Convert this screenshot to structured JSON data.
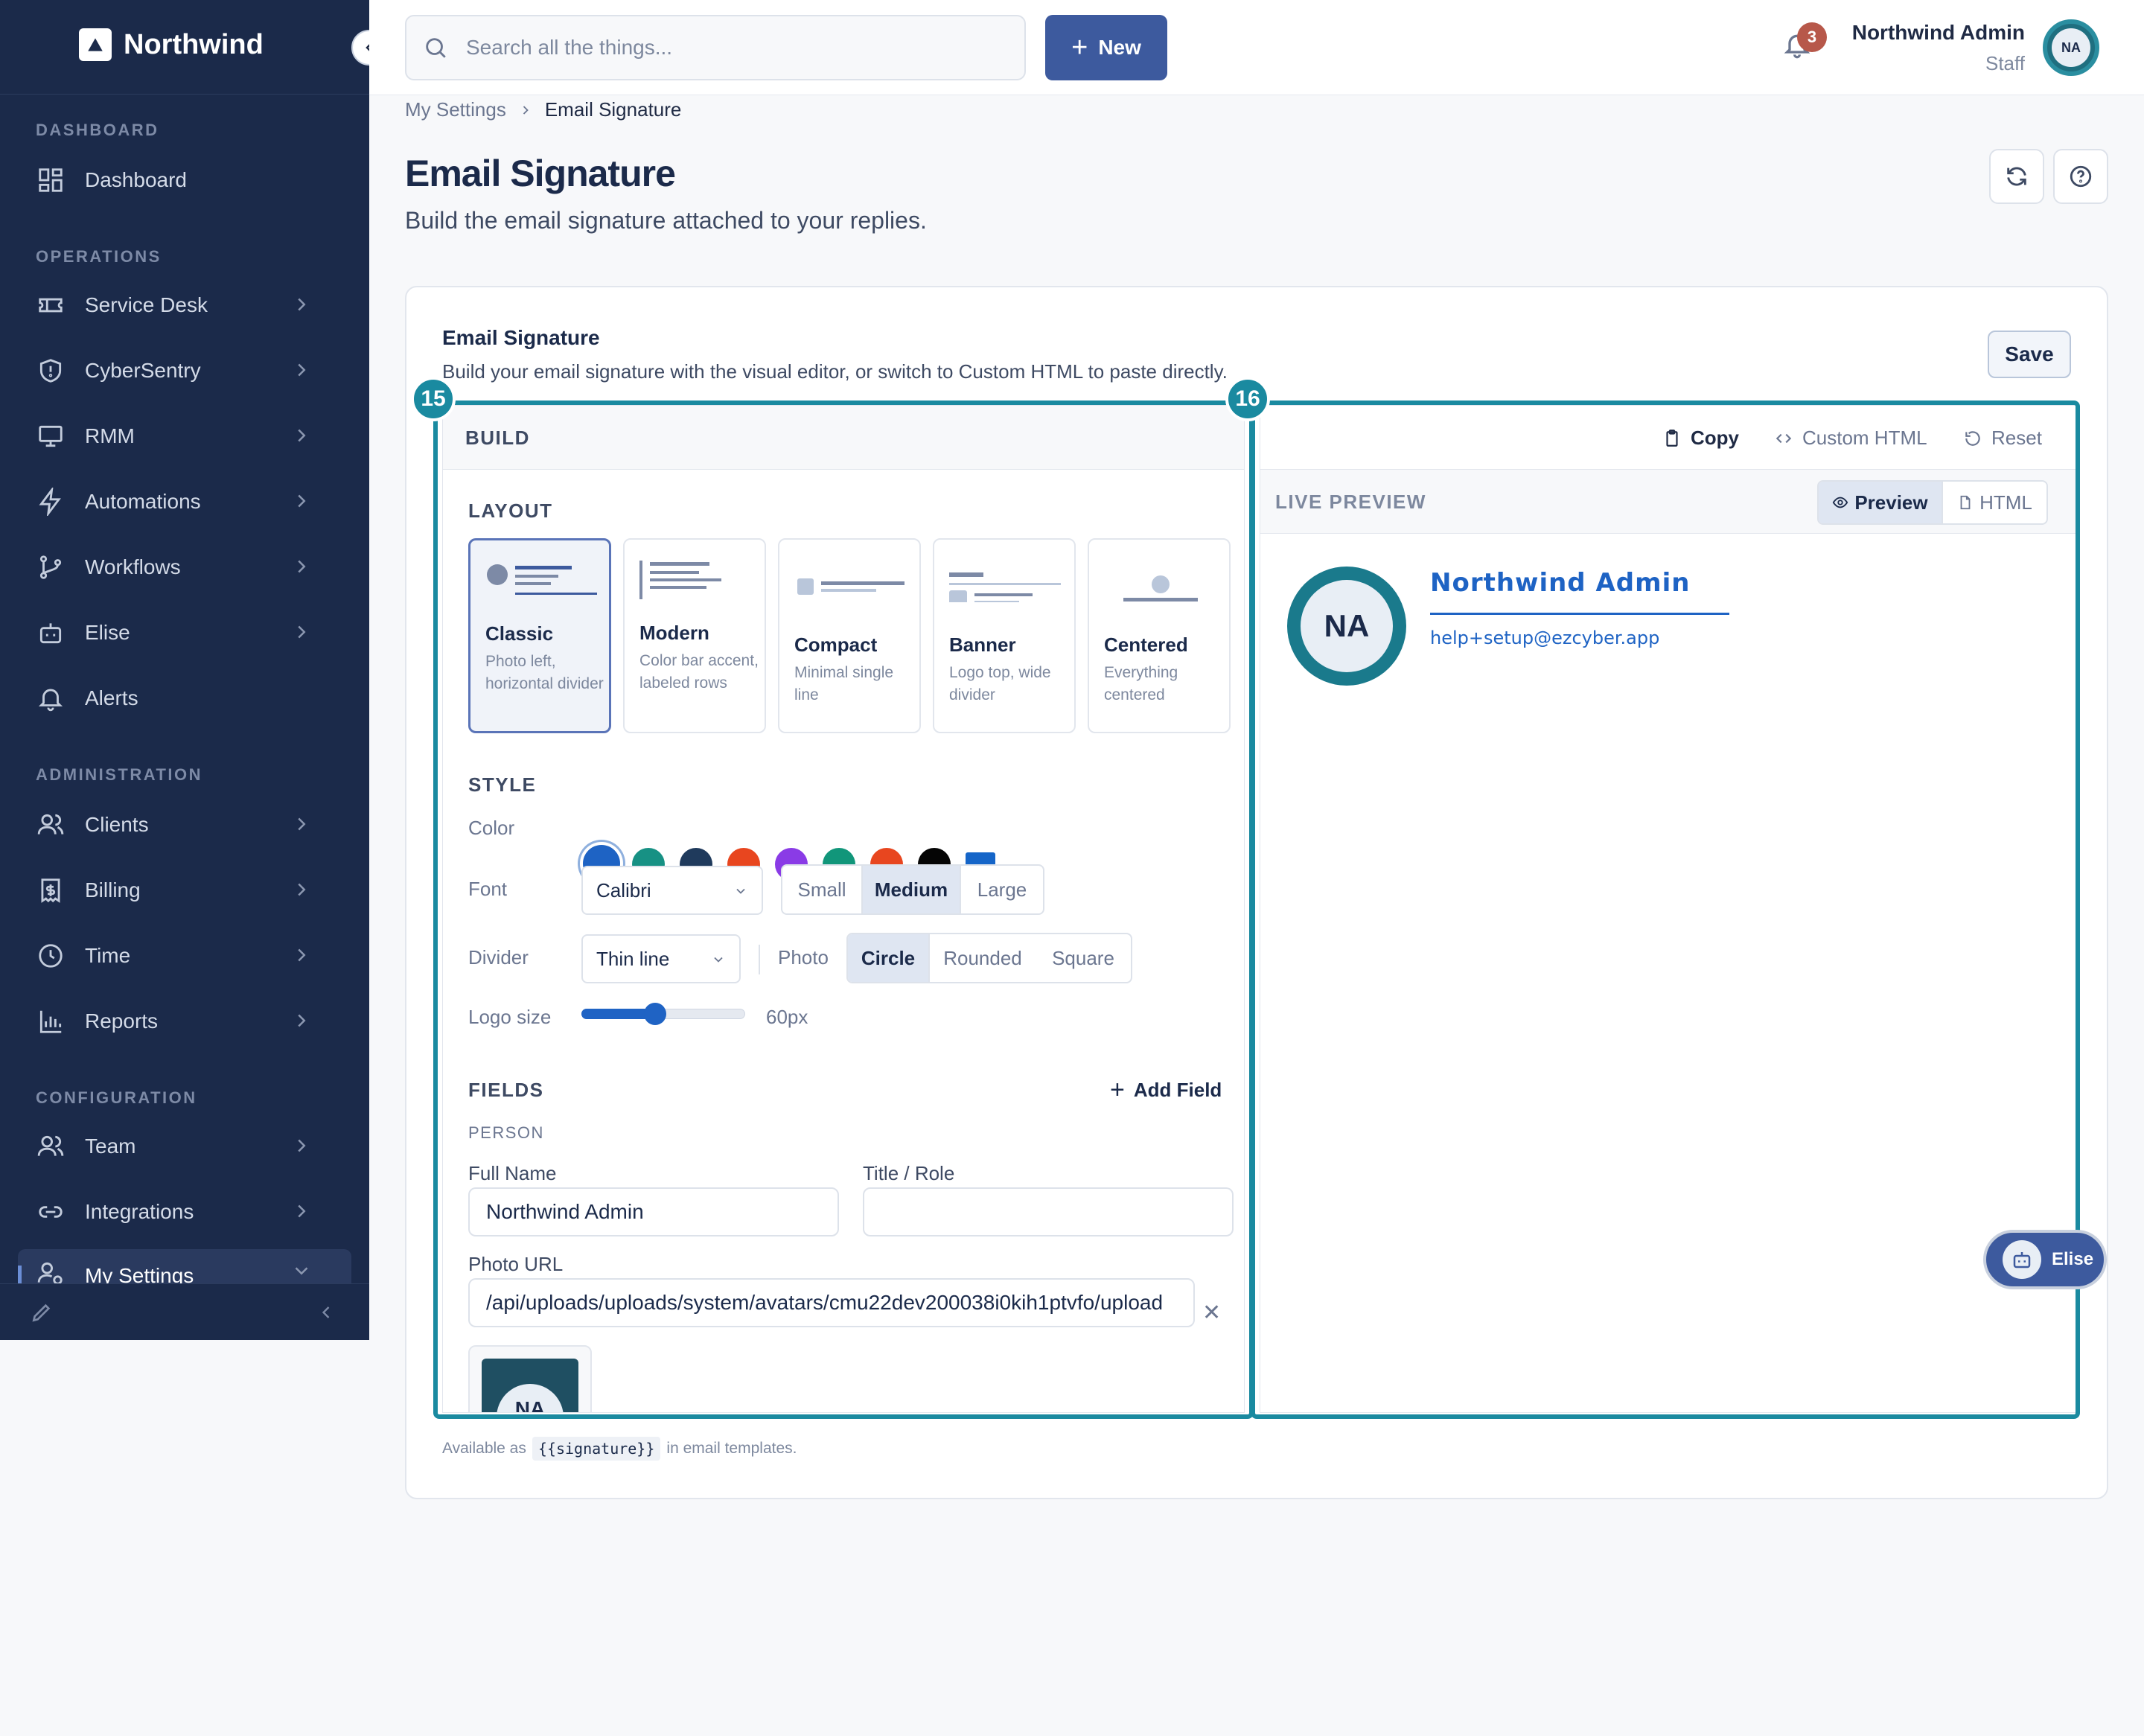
{
  "brand": {
    "name": "Northwind"
  },
  "sidebar": {
    "sections": [
      "DASHBOARD",
      "OPERATIONS",
      "ADMINISTRATION",
      "CONFIGURATION"
    ],
    "items": [
      {
        "label": "Dashboard",
        "icon": "grid-icon"
      },
      {
        "label": "Service Desk",
        "icon": "ticket-icon"
      },
      {
        "label": "CyberSentry",
        "icon": "shield-icon"
      },
      {
        "label": "RMM",
        "icon": "monitor-icon"
      },
      {
        "label": "Automations",
        "icon": "bolt-icon"
      },
      {
        "label": "Workflows",
        "icon": "branch-icon"
      },
      {
        "label": "Elise",
        "icon": "bot-icon"
      },
      {
        "label": "Alerts",
        "icon": "bell-icon"
      },
      {
        "label": "Clients",
        "icon": "users-icon"
      },
      {
        "label": "Billing",
        "icon": "receipt-icon"
      },
      {
        "label": "Time",
        "icon": "clock-icon"
      },
      {
        "label": "Reports",
        "icon": "bar-chart-icon"
      },
      {
        "label": "Team",
        "icon": "users-icon"
      },
      {
        "label": "Integrations",
        "icon": "link-icon"
      },
      {
        "label": "My Settings",
        "icon": "user-cog-icon"
      }
    ]
  },
  "topbar": {
    "search_placeholder": "Search all the things...",
    "new_label": "New",
    "notification_count": "3",
    "user_name": "Northwind Admin",
    "user_role": "Staff",
    "user_initials": "NA"
  },
  "breadcrumb": {
    "parent": "My Settings",
    "current": "Email Signature"
  },
  "page": {
    "title": "Email Signature",
    "subtitle": "Build the email signature attached to your replies."
  },
  "card": {
    "title": "Email Signature",
    "description": "Build your email signature with the visual editor, or switch to Custom HTML to paste directly.",
    "save_label": "Save"
  },
  "markers": {
    "build": "15",
    "preview": "16"
  },
  "build": {
    "header": "BUILD",
    "layout_label": "LAYOUT",
    "layouts": [
      {
        "title": "Classic",
        "desc": "Photo left, horizontal divider",
        "selected": true
      },
      {
        "title": "Modern",
        "desc": "Color bar accent, labeled rows",
        "selected": false
      },
      {
        "title": "Compact",
        "desc": "Minimal single line",
        "selected": false
      },
      {
        "title": "Banner",
        "desc": "Logo top, wide divider",
        "selected": false
      },
      {
        "title": "Centered",
        "desc": "Everything centered",
        "selected": false
      }
    ],
    "style_label": "STYLE",
    "color_label": "Color",
    "colors": [
      "#1e63c4",
      "#179184",
      "#1f3a5c",
      "#e8461f",
      "#8a3be6",
      "#11967a",
      "#e8461f",
      "#050505",
      "#1565c8"
    ],
    "selected_color": "#1e63c4",
    "font_label": "Font",
    "font_value": "Calibri",
    "sizes": [
      "Small",
      "Medium",
      "Large"
    ],
    "selected_size": "Medium",
    "divider_label": "Divider",
    "divider_value": "Thin line",
    "photo_label": "Photo",
    "photo_shapes": [
      "Circle",
      "Rounded",
      "Square"
    ],
    "selected_photo_shape": "Circle",
    "logo_size_label": "Logo size",
    "logo_size_value": "60px",
    "logo_size_fraction": 0.45,
    "fields_label": "FIELDS",
    "add_field_label": "Add Field",
    "person_label": "PERSON",
    "full_name_label": "Full Name",
    "full_name_value": "Northwind Admin",
    "title_role_label": "Title / Role",
    "title_role_value": "",
    "photo_url_label": "Photo URL",
    "photo_url_value": "/api/uploads/uploads/system/avatars/cmu22dev200038i0kih1ptvfo/upload",
    "thumb_initials": "NA"
  },
  "preview": {
    "copy_label": "Copy",
    "custom_html_label": "Custom HTML",
    "reset_label": "Reset",
    "live_preview_label": "LIVE PREVIEW",
    "tab_preview": "Preview",
    "tab_html": "HTML",
    "sig_initials": "NA",
    "sig_name": "Northwind Admin",
    "sig_email": "help+setup@ezcyber.app"
  },
  "fab": {
    "label": "Elise"
  },
  "footnote": {
    "prefix": "Available as",
    "token": "{{signature}}",
    "suffix": "in email templates."
  }
}
